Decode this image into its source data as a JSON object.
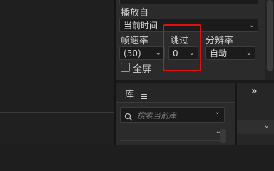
{
  "export": {
    "playback_label": "播放自",
    "playback_value": "当前时间",
    "framerate_label": "帧速率",
    "framerate_value": "(30)",
    "skip_label": "跳过",
    "skip_value": "0",
    "resolution_label": "分辨率",
    "resolution_value": "自动",
    "fullscreen_label": "全屏"
  },
  "library": {
    "title": "库",
    "search_placeholder": "搜索当前库"
  },
  "colors": {
    "highlight": "#e01010",
    "panel_bg": "#2b2b2b",
    "field_bg": "#1b1b1b"
  }
}
